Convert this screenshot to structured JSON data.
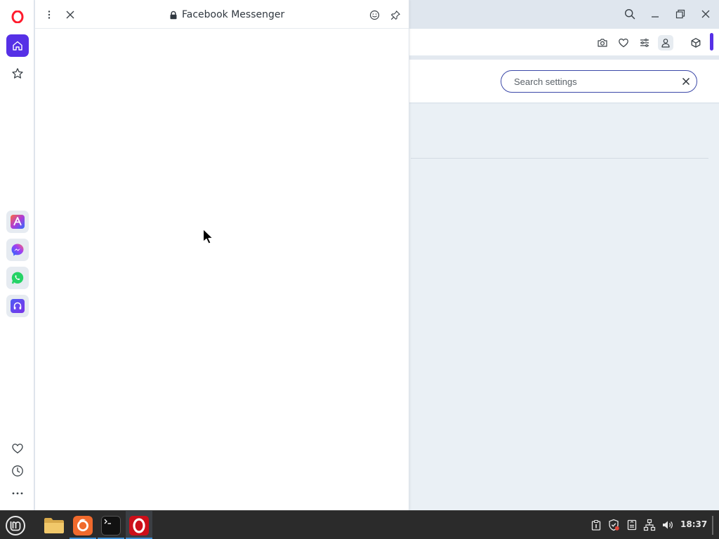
{
  "browser": {
    "name": "Opera",
    "accent_color": "#5630e6"
  },
  "sidebar": {
    "items": [
      {
        "name": "home",
        "icon": "home-icon",
        "active": true
      },
      {
        "name": "speed-dial",
        "icon": "star-outline-icon",
        "active": false
      }
    ],
    "apps": [
      {
        "name": "aria",
        "icon": "aria-ai-icon"
      },
      {
        "name": "facebook-messenger",
        "icon": "messenger-icon"
      },
      {
        "name": "whatsapp",
        "icon": "whatsapp-icon"
      },
      {
        "name": "player",
        "icon": "music-player-icon"
      }
    ],
    "bottom_items": [
      {
        "name": "bookmarks",
        "icon": "heart-outline-icon"
      },
      {
        "name": "history",
        "icon": "clock-icon"
      },
      {
        "name": "more",
        "icon": "more-dots-icon"
      }
    ]
  },
  "panel": {
    "title": "Facebook Messenger",
    "secure": true
  },
  "settings": {
    "search_placeholder": "Search settings"
  },
  "taskbar": {
    "apps": [
      {
        "name": "files",
        "icon": "folder-icon"
      },
      {
        "name": "firefox",
        "icon": "firefox-icon"
      },
      {
        "name": "terminal",
        "icon": "terminal-icon"
      },
      {
        "name": "opera",
        "icon": "opera-icon"
      }
    ],
    "clock": "18:37"
  }
}
